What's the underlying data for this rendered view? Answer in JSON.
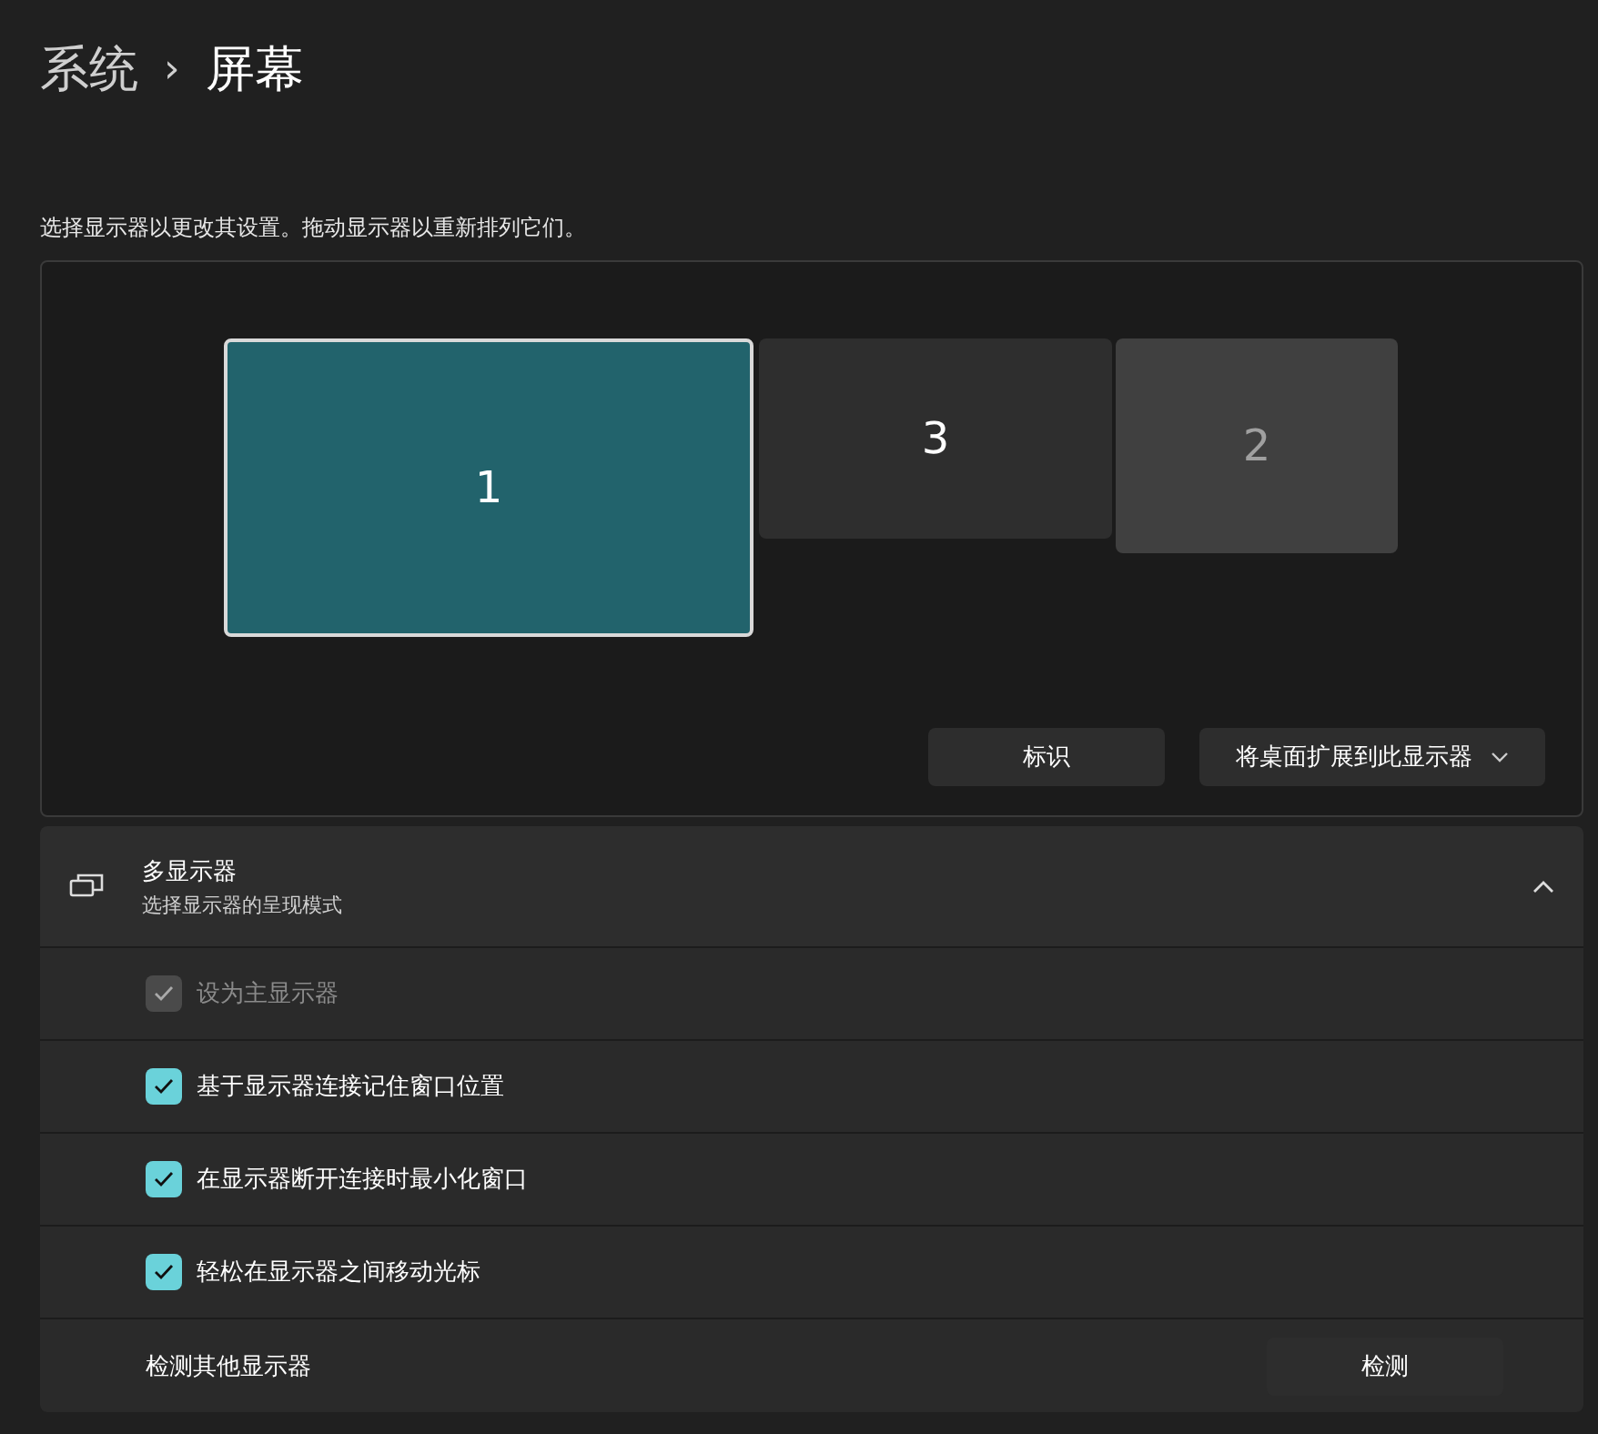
{
  "breadcrumb": {
    "parent": "系统",
    "separator": "›",
    "current": "屏幕"
  },
  "instruction": "选择显示器以更改其设置。拖动显示器以重新排列它们。",
  "monitors": [
    {
      "label": "1",
      "selected": true,
      "dimmed": false
    },
    {
      "label": "3",
      "selected": false,
      "dimmed": false
    },
    {
      "label": "2",
      "selected": false,
      "dimmed": true
    }
  ],
  "actions": {
    "identify": "标识",
    "extend": "将桌面扩展到此显示器"
  },
  "section": {
    "title": "多显示器",
    "subtitle": "选择显示器的呈现模式",
    "expanded": true,
    "options": [
      {
        "label": "设为主显示器",
        "checked": true,
        "disabled": true
      },
      {
        "label": "基于显示器连接记住窗口位置",
        "checked": true,
        "disabled": false
      },
      {
        "label": "在显示器断开连接时最小化窗口",
        "checked": true,
        "disabled": false
      },
      {
        "label": "轻松在显示器之间移动光标",
        "checked": true,
        "disabled": false
      }
    ],
    "detect": {
      "label": "检测其他显示器",
      "button": "检测"
    }
  }
}
